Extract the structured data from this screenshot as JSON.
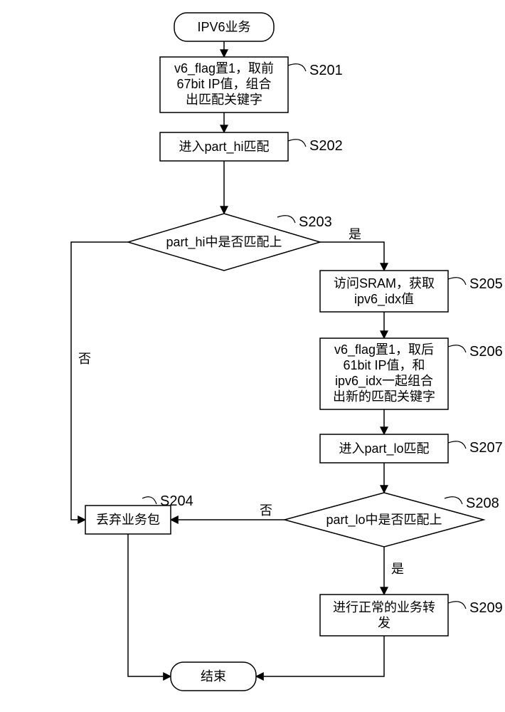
{
  "flow": {
    "start": "IPV6业务",
    "end": "结束",
    "s201_text1": "v6_flag置1，取前",
    "s201_text2": "67bit IP值，组合",
    "s201_text3": "出匹配关键字",
    "s201_label": "S201",
    "s202_text": "进入part_hi匹配",
    "s202_label": "S202",
    "s203_text": "part_hi中是否匹配上",
    "s203_label": "S203",
    "s204_text": "丢弃业务包",
    "s204_label": "S204",
    "s205_text1": "访问SRAM，获取",
    "s205_text2": "ipv6_idx值",
    "s205_label": "S205",
    "s206_text1": "v6_flag置1，取后",
    "s206_text2": "61bit IP值，和",
    "s206_text3": "ipv6_idx一起组合",
    "s206_text4": "出新的匹配关键字",
    "s206_label": "S206",
    "s207_text": "进入part_lo匹配",
    "s207_label": "S207",
    "s208_text": "part_lo中是否匹配上",
    "s208_label": "S208",
    "s209_text1": "进行正常的业务转",
    "s209_text2": "发",
    "s209_label": "S209",
    "yes": "是",
    "no": "否"
  }
}
